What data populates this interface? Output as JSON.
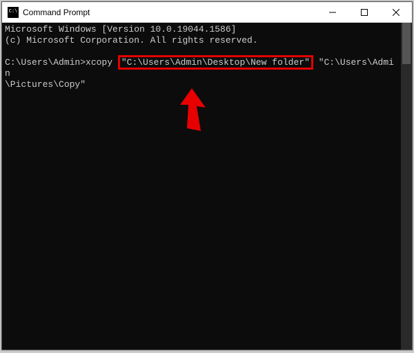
{
  "window": {
    "title": "Command Prompt"
  },
  "terminal": {
    "line1": "Microsoft Windows [Version 10.0.19044.1586]",
    "line2": "(c) Microsoft Corporation. All rights reserved.",
    "blank": "",
    "prompt": "C:\\Users\\Admin>",
    "command": "xcopy ",
    "source_path": "\"C:\\Users\\Admin\\Desktop\\New folder\"",
    "gap": " ",
    "dest_part1": "\"C:\\Users\\Admin",
    "dest_part2": "\\Pictures\\Copy\""
  }
}
